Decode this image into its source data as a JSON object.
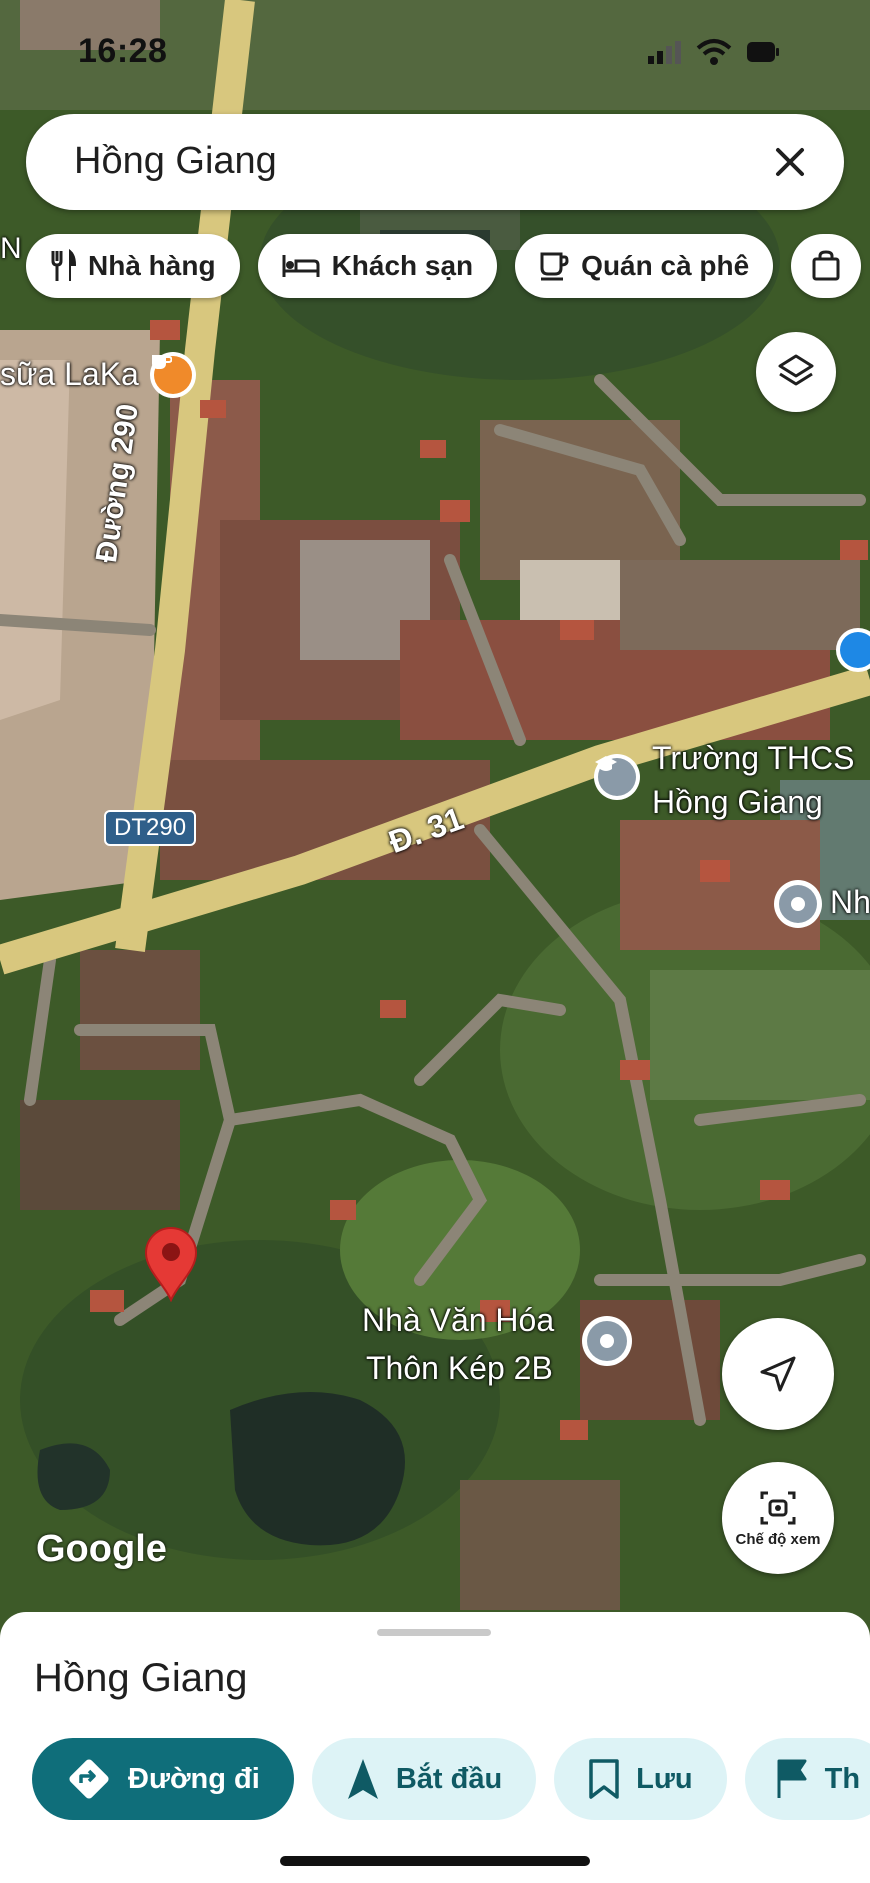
{
  "status": {
    "time": "16:28"
  },
  "search": {
    "query": "Hồng Giang"
  },
  "chips": [
    {
      "label": "Nhà hàng",
      "icon": "fork-knife-icon"
    },
    {
      "label": "Khách sạn",
      "icon": "bed-icon"
    },
    {
      "label": "Quán cà phê",
      "icon": "coffee-cup-icon"
    }
  ],
  "map": {
    "labels": {
      "cafe": "sữa LaKa",
      "school_line1": "Trường THCS",
      "school_line2": "Hồng Giang",
      "culture_line1": "Nhà Văn Hóa",
      "culture_line2": "Thôn Kép 2B",
      "partial_right": "Nh",
      "partial_top": "N"
    },
    "roads": {
      "duong290": "Đường 290",
      "d31": "Đ. 31",
      "dt290": "DT290"
    },
    "watermark": "Google",
    "view_mode_label": "Chế độ xem"
  },
  "sheet": {
    "title": "Hồng Giang",
    "actions": [
      {
        "label": "Đường đi",
        "icon": "directions-icon"
      },
      {
        "label": "Bắt đầu",
        "icon": "navigation-arrow-icon"
      },
      {
        "label": "Lưu",
        "icon": "bookmark-icon"
      },
      {
        "label": "Th",
        "icon": "flag-icon"
      }
    ]
  },
  "colors": {
    "accent": "#0f6e7a",
    "accent_light": "#ddf3f6",
    "pin": "#e53935",
    "road": "#e8d98a"
  }
}
